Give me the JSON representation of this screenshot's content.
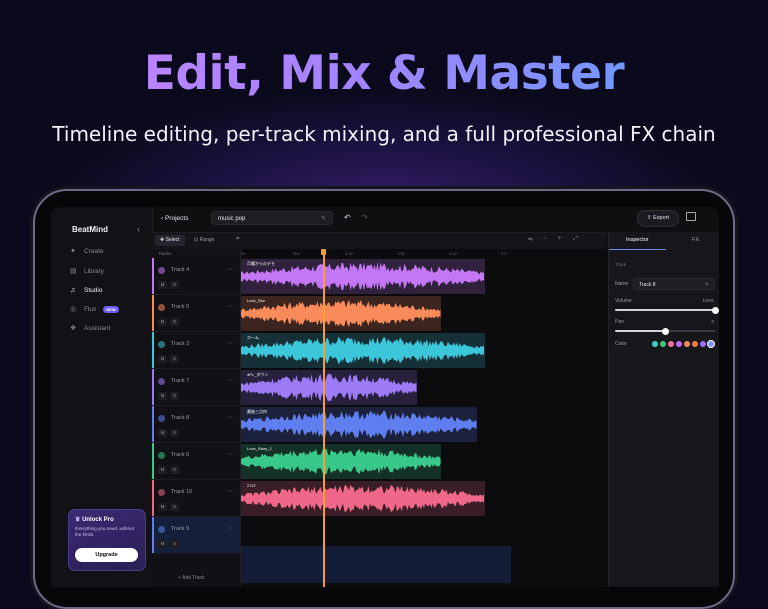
{
  "hero": {
    "title": "Edit, Mix & Master",
    "subtitle": "Timeline editing, per-track mixing, and a full professional FX chain"
  },
  "sidebar": {
    "brand": "BeatMind",
    "items": [
      {
        "label": "Create",
        "icon": "sparkle-icon"
      },
      {
        "label": "Library",
        "icon": "library-icon"
      },
      {
        "label": "Studio",
        "icon": "studio-icon",
        "active": true
      },
      {
        "label": "Flux",
        "icon": "flux-icon",
        "badge": "NEW"
      },
      {
        "label": "Assistant",
        "icon": "assistant-icon"
      }
    ],
    "promo": {
      "title": "Unlock Pro",
      "description": "Everything you need, without the limits.",
      "button": "Upgrade"
    }
  },
  "topbar": {
    "back_label": "Projects",
    "project_name": "music pop",
    "export_label": "Export"
  },
  "toolbar": {
    "select_label": "Select",
    "range_label": "Range"
  },
  "timeline": {
    "tracks_label": "Tracks",
    "ruler": [
      "0s",
      "30s",
      "1:00",
      "1:30",
      "2:00",
      "2:3"
    ],
    "add_track_label": "Add Track",
    "mute_label": "M",
    "solo_label": "S",
    "tracks": [
      {
        "name": "Track 4",
        "color": "#c477f5",
        "clip_label": "月曜からのデモ"
      },
      {
        "name": "Track 5",
        "color": "#f98a5a",
        "clip_label": "Love_Slur"
      },
      {
        "name": "Track 3",
        "color": "#3bc6d9",
        "clip_label": "ホーム"
      },
      {
        "name": "Track 7",
        "color": "#9d7af6",
        "clip_label": "4PL_ダウン"
      },
      {
        "name": "Track 8",
        "color": "#5f7ff0",
        "clip_label": "最後三点何"
      },
      {
        "name": "Track 6",
        "color": "#38c98a",
        "clip_label": "Love_Story_2"
      },
      {
        "name": "Track 10",
        "color": "#f06889",
        "clip_label": "2747"
      },
      {
        "name": "Track 9",
        "color": "#5f7ff0",
        "clip_label": ""
      }
    ]
  },
  "inspector": {
    "tabs": [
      "Inspector",
      "FX"
    ],
    "section": "Track",
    "name_label": "Name",
    "name_value": "Track 8",
    "volume_label": "Volume",
    "volume_value": "100%",
    "volume_level": 1.0,
    "pan_label": "Pan",
    "pan_value": "0",
    "pan_level": 0.5,
    "color_label": "Color",
    "swatches": [
      "#3fd1c1",
      "#34c97a",
      "#f16b9b",
      "#c46af5",
      "#f58b5a",
      "#ff7a4a",
      "#9f72f0",
      "#7f93ff"
    ]
  }
}
